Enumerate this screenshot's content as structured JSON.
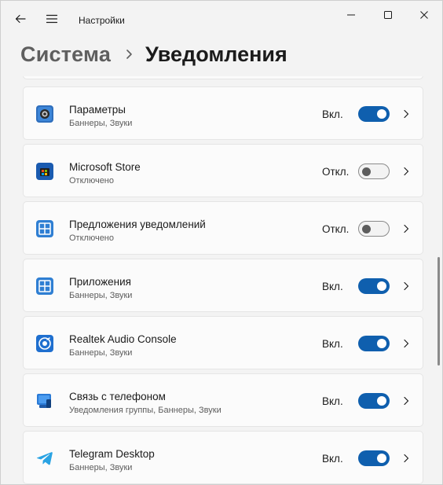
{
  "window": {
    "title": "Настройки"
  },
  "header": {
    "parent": "Система",
    "current": "Уведомления"
  },
  "apps": [
    {
      "name": "Параметры",
      "sub": "Баннеры, Звуки",
      "state": "Вкл.",
      "on": true,
      "icon": "settings-gear-icon"
    },
    {
      "name": "Microsoft Store",
      "sub": "Отключено",
      "state": "Откл.",
      "on": false,
      "icon": "store-bag-icon"
    },
    {
      "name": "Предложения уведомлений",
      "sub": "Отключено",
      "state": "Откл.",
      "on": false,
      "icon": "notification-grid-icon"
    },
    {
      "name": "Приложения",
      "sub": "Баннеры, Звуки",
      "state": "Вкл.",
      "on": true,
      "icon": "apps-grid-icon"
    },
    {
      "name": "Realtek Audio Console",
      "sub": "Баннеры, Звуки",
      "state": "Вкл.",
      "on": true,
      "icon": "speaker-icon"
    },
    {
      "name": "Связь с телефоном",
      "sub": "Уведомления группы, Баннеры, Звуки",
      "state": "Вкл.",
      "on": true,
      "icon": "phone-link-icon"
    },
    {
      "name": "Telegram Desktop",
      "sub": "Баннеры, Звуки",
      "state": "Вкл.",
      "on": true,
      "icon": "telegram-icon"
    }
  ],
  "colors": {
    "accent": "#0f5fae",
    "background": "#f3f3f3",
    "card": "#fbfbfb"
  }
}
